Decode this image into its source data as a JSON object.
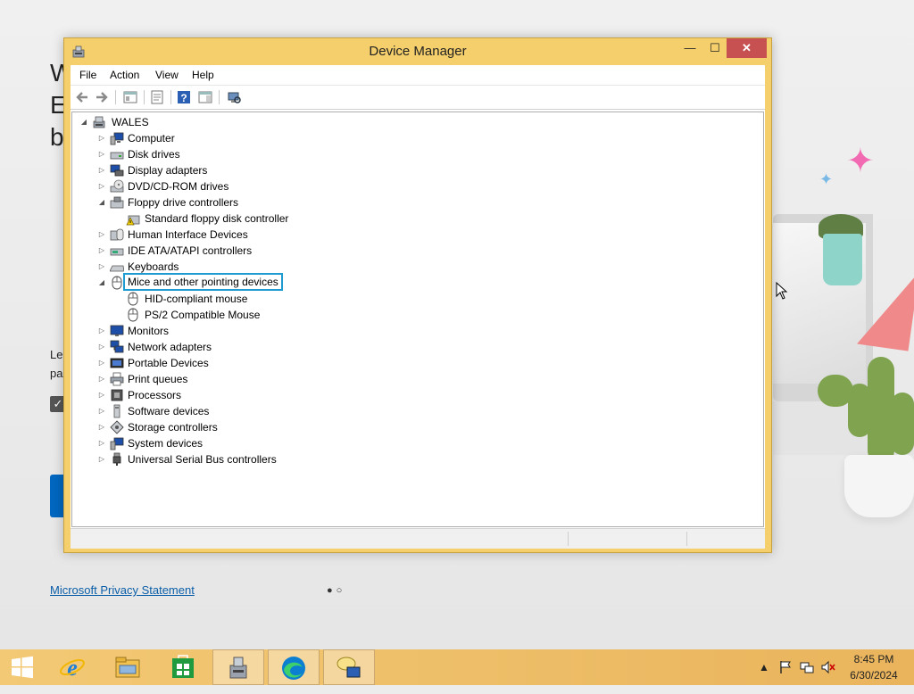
{
  "background": {
    "heading_lines": [
      "W",
      "E",
      "b"
    ],
    "text_lines": [
      "Le",
      "pa"
    ],
    "privacy_link": "Microsoft Privacy Statement"
  },
  "window": {
    "title": "Device Manager",
    "controls": {
      "minimize": "—",
      "maximize": "☐",
      "close": "✕"
    }
  },
  "menubar": [
    "File",
    "Action",
    "View",
    "Help"
  ],
  "toolbar": [
    "back-arrow-icon",
    "forward-arrow-icon",
    "show-hide-tree-icon",
    "properties-icon",
    "help-icon",
    "action-pane-icon",
    "scan-hardware-icon"
  ],
  "tree": {
    "root": "WALES",
    "categories": [
      {
        "label": "Computer",
        "expanded": false,
        "icon": "computer-icon"
      },
      {
        "label": "Disk drives",
        "expanded": false,
        "icon": "disk-drive-icon"
      },
      {
        "label": "Display adapters",
        "expanded": false,
        "icon": "display-adapter-icon"
      },
      {
        "label": "DVD/CD-ROM drives",
        "expanded": false,
        "icon": "dvd-drive-icon"
      },
      {
        "label": "Floppy drive controllers",
        "expanded": true,
        "icon": "floppy-controller-icon",
        "children": [
          {
            "label": "Standard floppy disk controller",
            "icon": "floppy-warning-icon"
          }
        ]
      },
      {
        "label": "Human Interface Devices",
        "expanded": false,
        "icon": "hid-icon"
      },
      {
        "label": "IDE ATA/ATAPI controllers",
        "expanded": false,
        "icon": "ide-controller-icon"
      },
      {
        "label": "Keyboards",
        "expanded": false,
        "icon": "keyboard-icon"
      },
      {
        "label": "Mice and other pointing devices",
        "expanded": true,
        "selected": true,
        "icon": "mouse-icon",
        "children": [
          {
            "label": "HID-compliant mouse",
            "icon": "mouse-icon"
          },
          {
            "label": "PS/2 Compatible Mouse",
            "icon": "mouse-icon"
          }
        ]
      },
      {
        "label": "Monitors",
        "expanded": false,
        "icon": "monitor-icon"
      },
      {
        "label": "Network adapters",
        "expanded": false,
        "icon": "network-adapter-icon"
      },
      {
        "label": "Portable Devices",
        "expanded": false,
        "icon": "portable-device-icon"
      },
      {
        "label": "Print queues",
        "expanded": false,
        "icon": "printer-icon"
      },
      {
        "label": "Processors",
        "expanded": false,
        "icon": "processor-icon"
      },
      {
        "label": "Software devices",
        "expanded": false,
        "icon": "software-device-icon"
      },
      {
        "label": "Storage controllers",
        "expanded": false,
        "icon": "storage-controller-icon"
      },
      {
        "label": "System devices",
        "expanded": false,
        "icon": "system-device-icon"
      },
      {
        "label": "Universal Serial Bus controllers",
        "expanded": false,
        "icon": "usb-icon"
      }
    ]
  },
  "taskbar": {
    "apps": [
      "internet-explorer-icon",
      "file-explorer-icon",
      "store-icon",
      "device-manager-icon",
      "edge-icon",
      "chat-icon"
    ],
    "active": "device-manager-icon",
    "tray_icons": [
      "chevron-up-icon",
      "flag-icon",
      "network-icon",
      "volume-muted-icon"
    ],
    "time": "8:45 PM",
    "date": "6/30/2024"
  },
  "colors": {
    "window_frame": "#f5cf6b",
    "close_button": "#c75050",
    "selection_border": "#1f9bd1",
    "taskbar": "#e9b45c"
  }
}
